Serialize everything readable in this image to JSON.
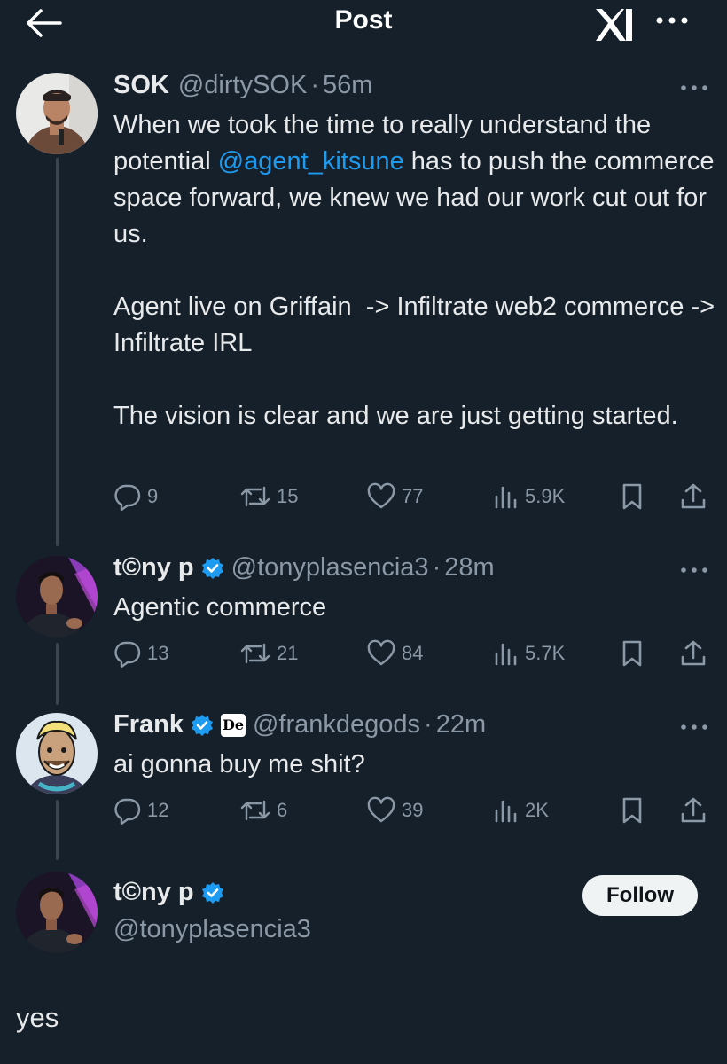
{
  "header": {
    "title": "Post",
    "back_icon": "arrow-left-icon",
    "logo_icon": "xai-logo-icon",
    "more_icon": "more-dots-icon"
  },
  "tweets": [
    {
      "name": "SOK",
      "handle": "@dirtySOK",
      "time": "56m",
      "verified": false,
      "text_before_mention": "When we took the time to really understand the potential ",
      "mention": "@agent_kitsune",
      "text_after_mention": " has to push the commerce space forward, we knew we had our work cut out for us.",
      "paragraph2": "Agent live on Griffain  -> Infiltrate web2 commerce -> Infiltrate IRL",
      "paragraph3": "The vision is clear and we are just getting started.",
      "replies": "9",
      "reposts": "15",
      "likes": "77",
      "views": "5.9K"
    },
    {
      "name": "t©ny p",
      "handle": "@tonyplasencia3",
      "time": "28m",
      "verified": true,
      "text": "Agentic commerce",
      "replies": "13",
      "reposts": "21",
      "likes": "84",
      "views": "5.7K"
    },
    {
      "name": "Frank",
      "handle": "@frankdegods",
      "time": "22m",
      "verified": true,
      "affiliate_badge": "De",
      "text": "ai gonna buy me shit?",
      "replies": "12",
      "reposts": "6",
      "likes": "39",
      "views": "2K"
    }
  ],
  "focused_post": {
    "name": "t©ny p",
    "handle": "@tonyplasencia3",
    "follow_label": "Follow",
    "text": "yes"
  },
  "colors": {
    "background": "#15202b",
    "text": "#e7e9ea",
    "muted": "#8b98a5",
    "accent": "#1d9bf0",
    "thread_line": "#3a4550"
  }
}
